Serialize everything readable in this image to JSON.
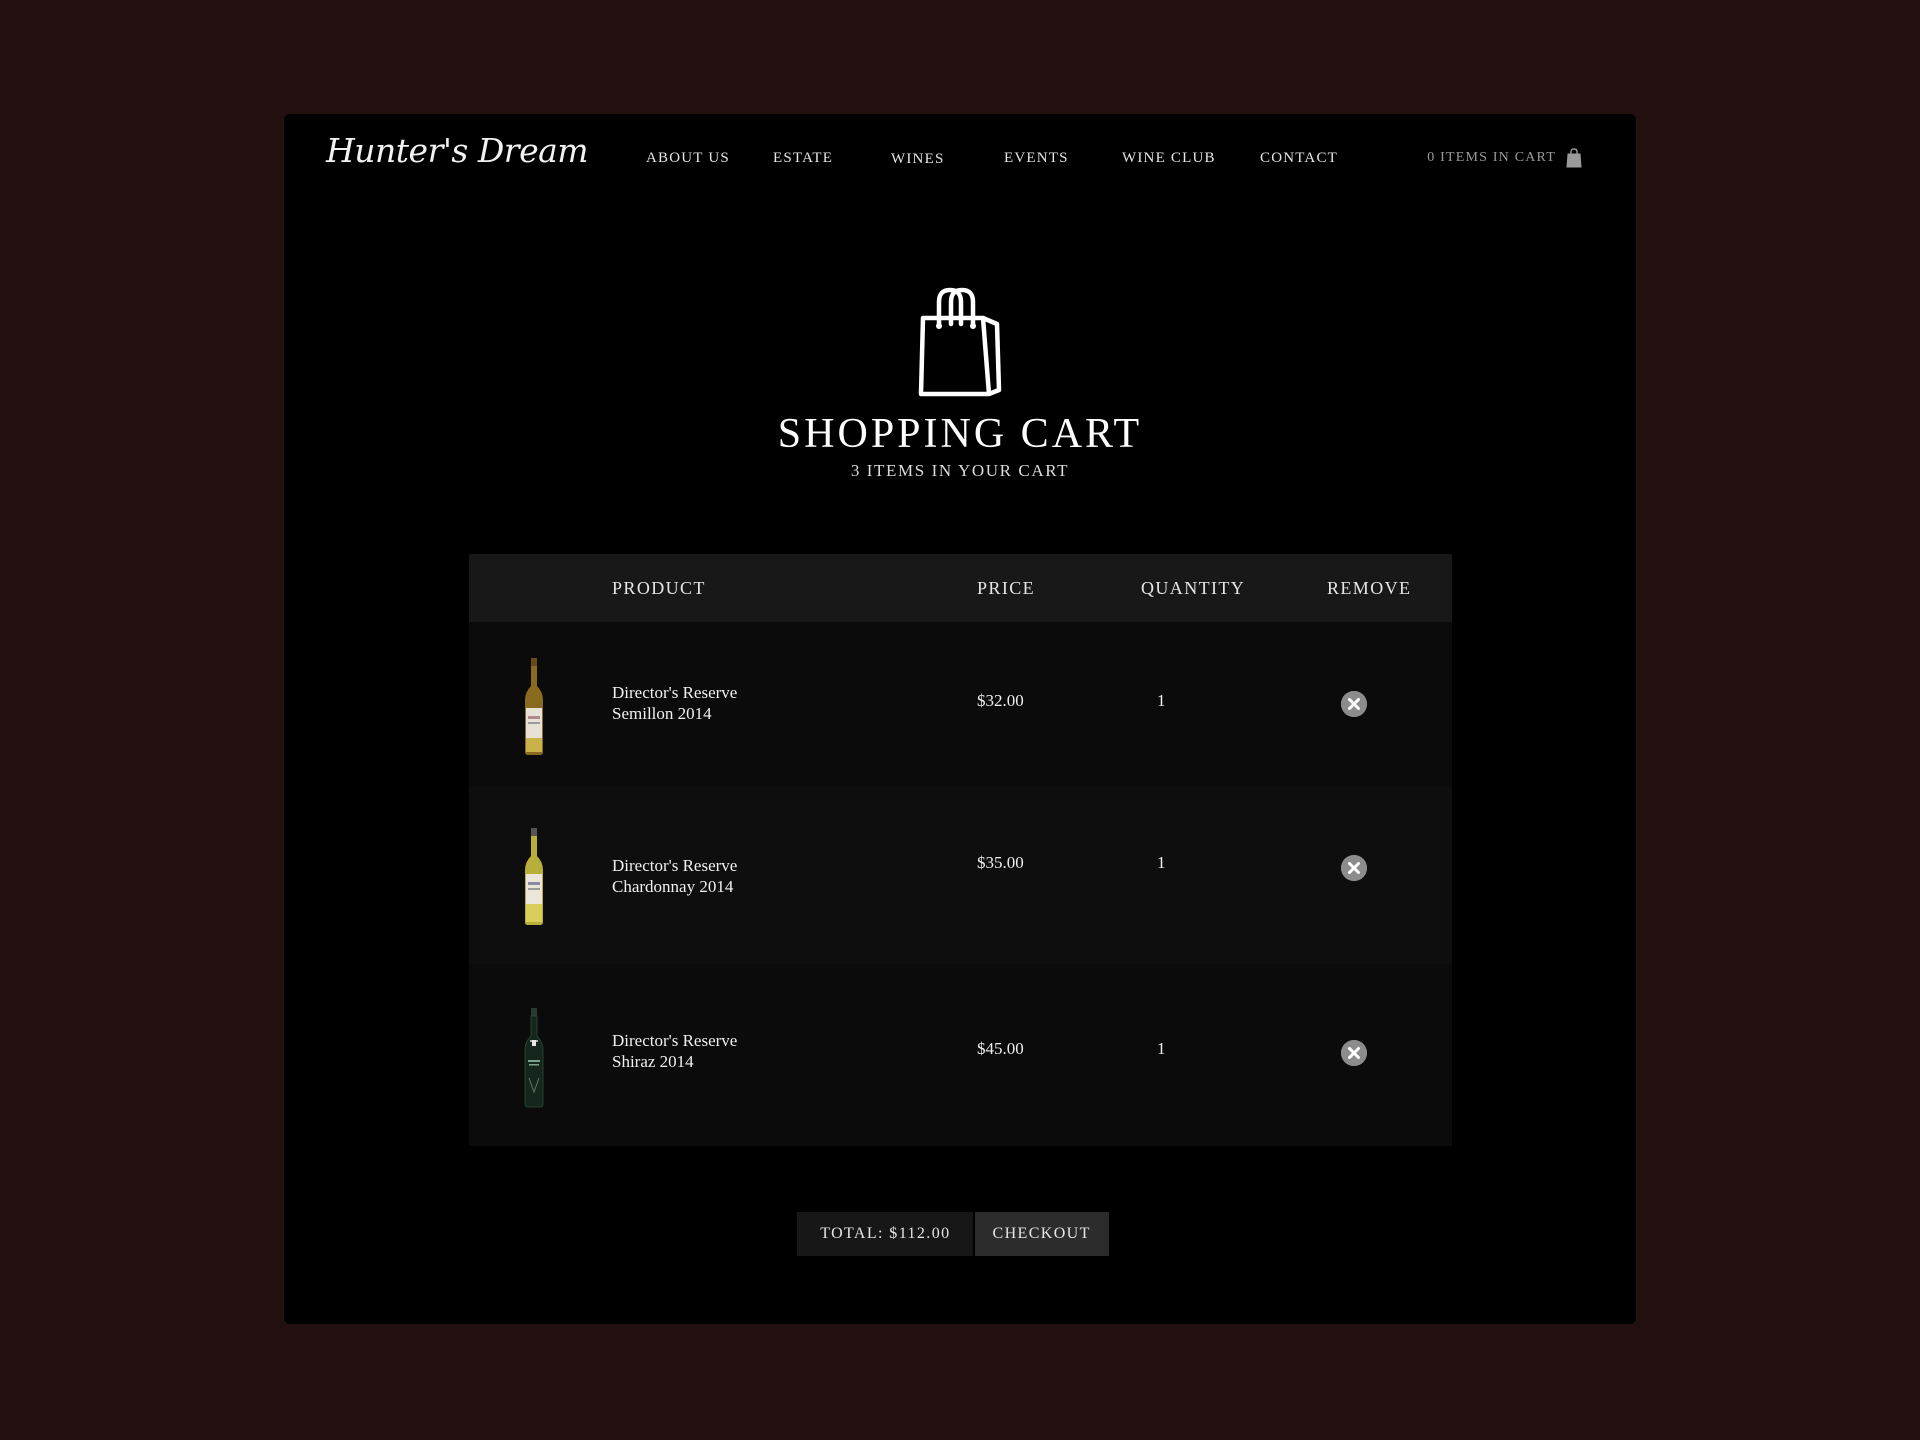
{
  "brand": {
    "logo_text": "Hunter's Dream"
  },
  "nav": {
    "items": [
      {
        "label": "ABOUT US"
      },
      {
        "label": "ESTATE"
      },
      {
        "label": "WINES"
      },
      {
        "label": "EVENTS"
      },
      {
        "label": "WINE CLUB"
      },
      {
        "label": "CONTACT"
      }
    ],
    "cart_label": "0 ITEMS IN CART",
    "cart_icon": "shopping-bag-icon"
  },
  "hero": {
    "icon": "shopping-bag-icon",
    "title": "SHOPPING CART",
    "subtitle": "3 ITEMS IN YOUR CART"
  },
  "table": {
    "headers": {
      "product": "PRODUCT",
      "price": "PRICE",
      "quantity": "QUANTITY",
      "remove": "REMOVE"
    },
    "rows": [
      {
        "name_line1": "Director's Reserve",
        "name_line2": "Semillon 2014",
        "price": "$32.00",
        "quantity": "1",
        "bottle_color": "#c9b24a",
        "remove_icon": "close-circle-icon"
      },
      {
        "name_line1": "Director's Reserve",
        "name_line2": "Chardonnay 2014",
        "price": "$35.00",
        "quantity": "1",
        "bottle_color": "#d8cf5a",
        "remove_icon": "close-circle-icon"
      },
      {
        "name_line1": "Director's Reserve",
        "name_line2": "Shiraz 2014",
        "price": "$45.00",
        "quantity": "1",
        "bottle_color": "#1f3a2a",
        "remove_icon": "close-circle-icon"
      }
    ]
  },
  "summary": {
    "total_label": "TOTAL: $112.00",
    "checkout_label": "CHECKOUT"
  },
  "colors": {
    "page_background": "#231112",
    "window_background": "#000000",
    "header_row": "#181818",
    "remove_button": "#8c8c8c",
    "checkout_button": "#2c2c2c"
  }
}
